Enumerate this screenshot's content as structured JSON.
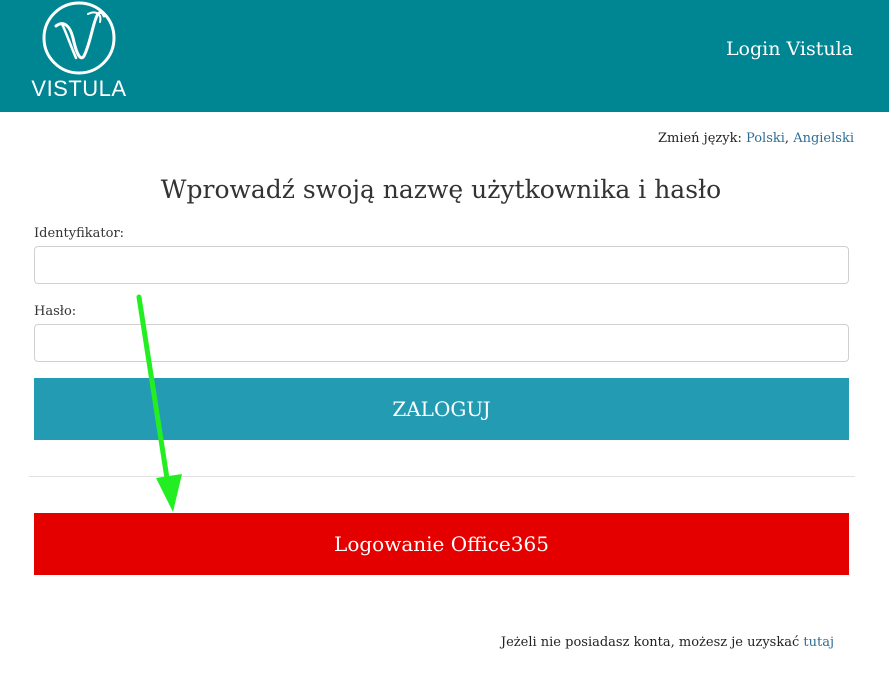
{
  "header": {
    "logo_text": "VISTULA",
    "title": "Login Vistula"
  },
  "language": {
    "label": "Zmień język:",
    "polish": "Polski",
    "separator": ",",
    "english": "Angielski"
  },
  "form": {
    "heading": "Wprowadź swoją nazwę użytkownika i hasło",
    "id_label": "Identyfikator:",
    "id_value": "",
    "password_label": "Hasło:",
    "password_value": "",
    "login_button": "ZALOGUJ"
  },
  "office365": {
    "button_label": "Logowanie Office365"
  },
  "footer": {
    "text": "Jeżeli nie posiadasz konta, możesz je uzyskać",
    "link": "tutaj"
  },
  "colors": {
    "header_bg": "#008693",
    "login_button": "#239cb3",
    "office_button": "#e50000",
    "link": "#2e6e95",
    "annotation_arrow": "#22ee22"
  },
  "icons": {
    "logo": "vistula-v-logo-icon",
    "annotation": "green-arrow-annotation"
  }
}
